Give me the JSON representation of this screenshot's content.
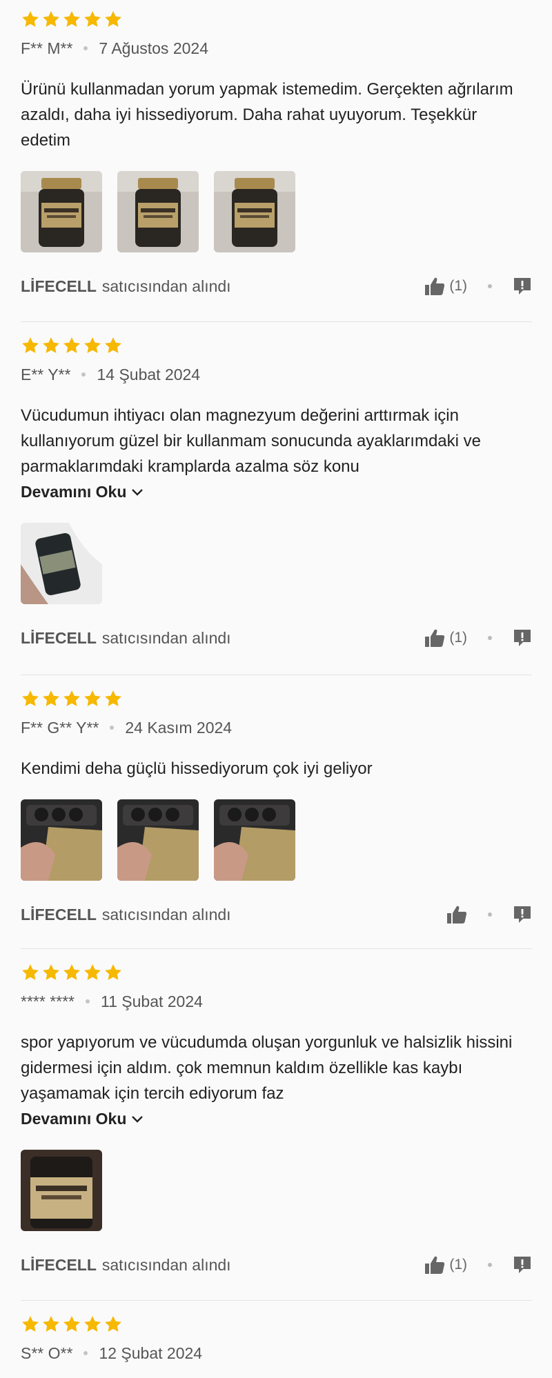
{
  "colors": {
    "star": "#f6b800",
    "icon": "#666666",
    "divider": "#e2e2e2"
  },
  "reviews": [
    {
      "rating": 5,
      "author": "F** M**",
      "date": "7 Ağustos 2024",
      "text_lines": [
        "Ürünü kullanmadan yorum yapmak istemedim. Gerçekten ağrılarım",
        "azaldı, daha iyi hissediyorum. Daha rahat uyuyorum. Teşekkür",
        "edetim"
      ],
      "read_more": "",
      "images": [
        "magnesium-bottle-photo",
        "magnesium-bottle-photo",
        "magnesium-bottle-photo"
      ],
      "seller_name": "LİFECELL",
      "seller_suffix": "satıcısından alındı",
      "likes": "(1)"
    },
    {
      "rating": 5,
      "author": "E** Y**",
      "date": "14 Şubat 2024",
      "text_lines": [
        "Vücudumun ihtiyacı olan magnezyum değerini arttırmak için",
        "kullanıyorum güzel bir kullanmam sonucunda ayaklarımdaki ve",
        "parmaklarımdaki kramplarda azalma söz konu"
      ],
      "read_more": "Devamını Oku",
      "images": [
        "omega-bottle-photo"
      ],
      "seller_name": "LİFECELL",
      "seller_suffix": "satıcısından alındı",
      "likes": "(1)"
    },
    {
      "rating": 5,
      "author": "F** G** Y**",
      "date": "24 Kasım 2024",
      "text_lines": [
        "Kendimi deha güçlü hissediyorum çok iyi geliyor"
      ],
      "read_more": "",
      "images": [
        "hand-bottle-photo",
        "hand-bottle-photo",
        "hand-bottle-photo"
      ],
      "seller_name": "LİFECELL",
      "seller_suffix": "satıcısından alındı",
      "likes": ""
    },
    {
      "rating": 5,
      "author": "**** ****",
      "date": "11 Şubat 2024",
      "text_lines": [
        "spor yapıyorum ve vücudumda oluşan yorgunluk ve halsizlik hissini",
        "gidermesi için aldım. çok memnun kaldım özellikle kas kaybı",
        "yaşamamak için tercih ediyorum faz"
      ],
      "read_more": "Devamını Oku",
      "images": [
        "magnesium-label-photo"
      ],
      "seller_name": "LİFECELL",
      "seller_suffix": "satıcısından alındı",
      "likes": "(1)"
    },
    {
      "rating": 5,
      "author": "S** O**",
      "date": "12 Şubat 2024"
    }
  ]
}
